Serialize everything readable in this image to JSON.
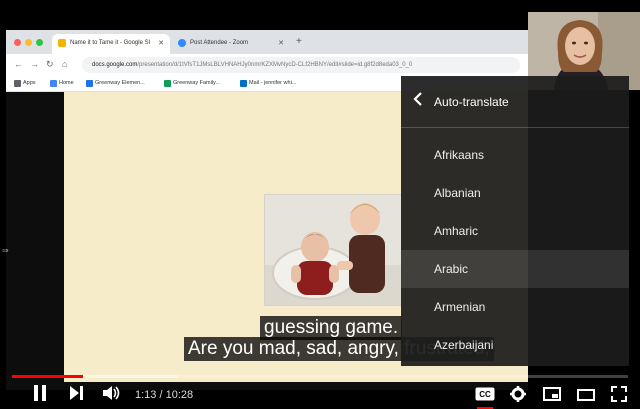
{
  "browser": {
    "tabs": [
      {
        "label": "Name it to Tame it - Google Sl",
        "active": true,
        "favicon_color": "#f4b400"
      },
      {
        "label": "Post Attendee - Zoom",
        "active": false,
        "favicon_color": "#2d8cff"
      }
    ],
    "url_host": "docs.google.com",
    "url_path": "/presentation/d/1tVfsT1JMsLBLVHNAHJy0nmrKZXMvNycD-CLf2HBNY/edit#slide=id.g8f2d8eda03_0_0",
    "bookmarks": [
      {
        "label": "Apps",
        "icon_color": "#5f6368"
      },
      {
        "label": "Home",
        "icon_color": "#4285f4"
      },
      {
        "label": "Greenway Elemen...",
        "icon_color": "#1a73e8"
      },
      {
        "label": "Greenway Family...",
        "icon_color": "#0f9d58"
      },
      {
        "label": "Mail - jennifer whi...",
        "icon_color": "#0072c6"
      }
    ]
  },
  "captions": {
    "line1": "guessing game.",
    "line2": "Are you mad, sad, angry, frustrated,"
  },
  "menu": {
    "back_icon": "chevron-left-icon",
    "title": "Auto-translate",
    "items": [
      "Afrikaans",
      "Albanian",
      "Amharic",
      "Arabic",
      "Armenian",
      "Azerbaijani"
    ],
    "highlighted_item": "Arabic"
  },
  "player": {
    "current_time": "1:13",
    "duration": "10:28",
    "time_display": "1:13 / 10:28",
    "played_fraction": 0.116,
    "loaded_fraction": 0.27,
    "accent_color": "#ff0000",
    "icons": [
      "pause-icon",
      "next-icon",
      "volume-icon",
      "cc-icon",
      "settings-icon",
      "miniplayer-icon",
      "theater-icon",
      "fullscreen-icon"
    ]
  }
}
